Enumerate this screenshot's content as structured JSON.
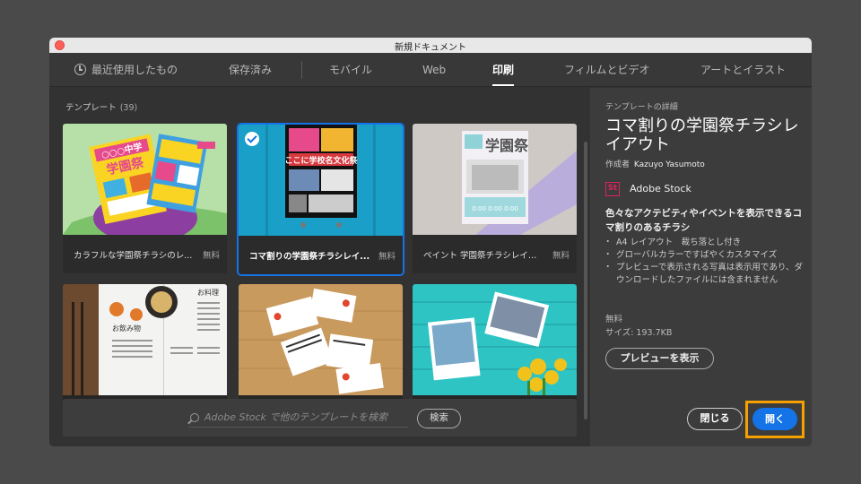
{
  "window": {
    "title": "新規ドキュメント"
  },
  "tabs": [
    {
      "label": "最近使用したもの",
      "icon": "clock-icon"
    },
    {
      "label": "保存済み"
    },
    {
      "label": "モバイル"
    },
    {
      "label": "Web"
    },
    {
      "label": "印刷",
      "active": true
    },
    {
      "label": "フィルムとビデオ"
    },
    {
      "label": "アートとイラスト"
    }
  ],
  "templates": {
    "heading": "テンプレート",
    "count": "(39)",
    "items": [
      {
        "name": "カラフルな学園祭チラシのレ...",
        "price": "無料"
      },
      {
        "name": "コマ割りの学園祭チラシレイ...",
        "price": "無料",
        "selected": true
      },
      {
        "name": "ペイント 学園祭チラシレイア...",
        "price": "無料"
      },
      {
        "name": "",
        "price": ""
      },
      {
        "name": "",
        "price": ""
      },
      {
        "name": "",
        "price": ""
      }
    ],
    "thumbnail_text": {
      "poster1": "○○○中学",
      "poster1b": "学園祭",
      "poster2": "ここに学校名文化祭",
      "poster3": "学園祭",
      "poster3b": "0:00 0:00 0:00",
      "menu_title": "お料理",
      "menu_drinks": "お飲み物"
    }
  },
  "search": {
    "placeholder": "Adobe Stock で他のテンプレートを検索",
    "button": "検索"
  },
  "details": {
    "caption": "テンプレートの詳細",
    "title": "コマ割りの学園祭チラシレイアウト",
    "author_prefix": "作成者",
    "author": "Kazuyo Yasumoto",
    "stock_logo": "St",
    "stock_label": "Adobe Stock",
    "description": "色々なアクテビティやイベントを表示できるコマ割りのあるチラシ",
    "bullets": [
      "A4 レイアウト　裁ち落とし付き",
      "グローバルカラーですばやくカスタマイズ",
      "プレビューで表示される写真は表示用であり、ダウンロードしたファイルには含まれません"
    ],
    "price": "無料",
    "size": "サイズ: 193.7KB",
    "preview_button": "プレビューを表示",
    "close_button": "閉じる",
    "open_button": "開く"
  },
  "colors": {
    "accent": "#1473e6",
    "highlight": "#f5a000",
    "panel": "#323232",
    "detail_panel": "#3c3c3c"
  }
}
